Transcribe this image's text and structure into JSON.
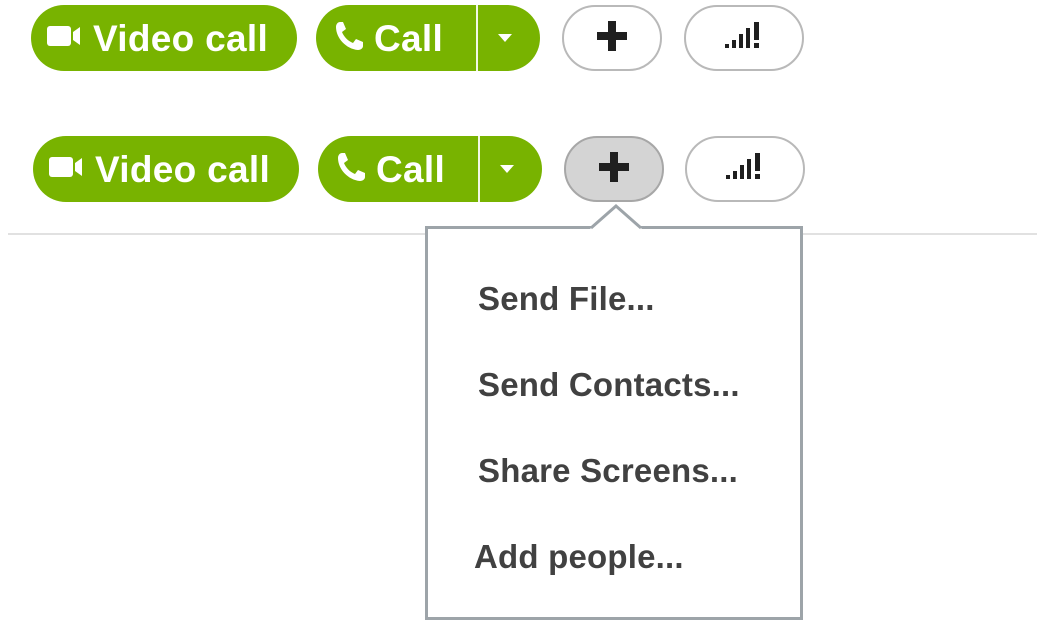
{
  "toolbar_default": {
    "video_call_label": "Video call",
    "call_label": "Call",
    "icons": {
      "video": "video-camera-icon",
      "phone": "phone-icon",
      "dropdown": "chevron-down-icon",
      "add": "plus-icon",
      "signal": "call-quality-signal-icon"
    },
    "state": "normal"
  },
  "toolbar_active": {
    "video_call_label": "Video call",
    "call_label": "Call",
    "state": "add-menu-open"
  },
  "add_menu": {
    "items": [
      {
        "label": "Send File..."
      },
      {
        "label": "Send Contacts..."
      },
      {
        "label": "Share Screens..."
      },
      {
        "label": "Add people..."
      }
    ]
  },
  "colors": {
    "accent_green": "#78b300",
    "menu_text": "#414141",
    "menu_border": "#9da4a9",
    "pressed_button": "#d4d4d4"
  }
}
